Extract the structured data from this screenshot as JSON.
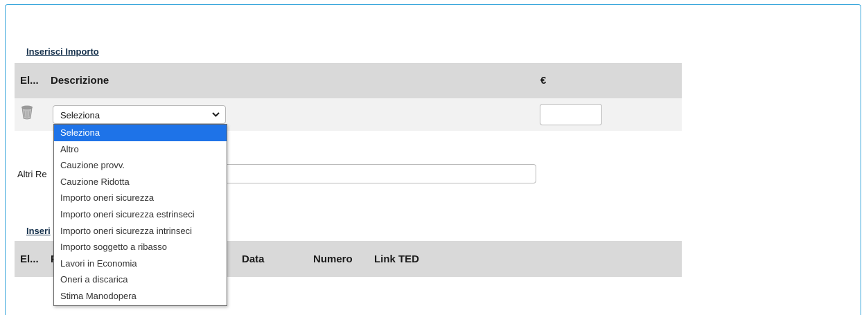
{
  "section_importo": {
    "link": "Inserisci Importo"
  },
  "importo_table": {
    "headers": [
      "El...",
      "Descrizione",
      "€"
    ],
    "row": {
      "select_value": "Seleziona"
    }
  },
  "dropdown": {
    "options": [
      "Seleziona",
      "Altro",
      "Cauzione provv.",
      "Cauzione Ridotta",
      "Importo oneri sicurezza",
      "Importo oneri sicurezza estrinseci",
      "Importo oneri sicurezza intrinseci",
      "Importo soggetto a ribasso",
      "Lavori in Economia",
      "Oneri a discarica",
      "Stima Manodopera"
    ],
    "selected_index": 0
  },
  "altri": {
    "label": "Altri Re"
  },
  "section_second": {
    "link": "Inseri"
  },
  "second_table": {
    "headers": [
      "El...",
      "P",
      "Data",
      "Numero",
      "Link TED"
    ]
  },
  "colors": {
    "accent_border": "#3aa7dc",
    "selected_option": "#1e73e8",
    "link": "#17324d"
  }
}
